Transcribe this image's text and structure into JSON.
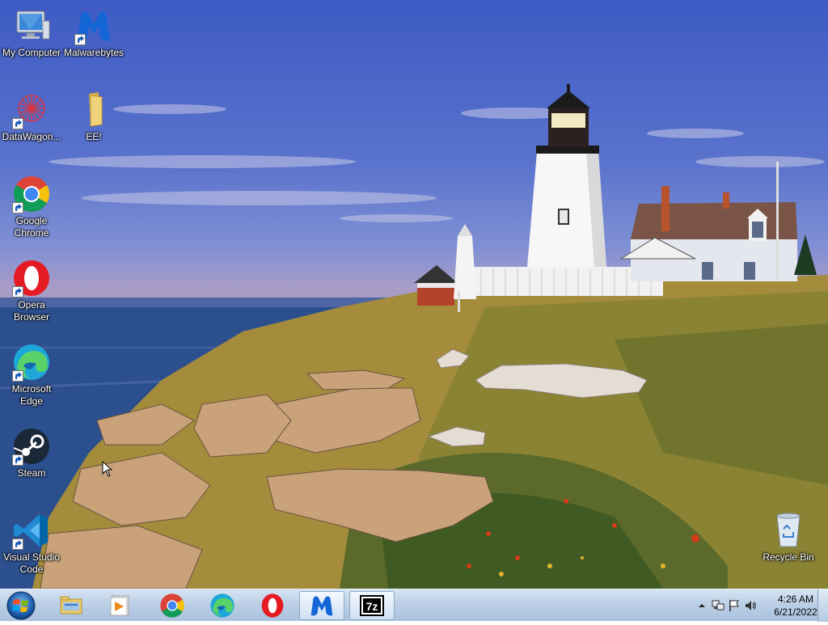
{
  "desktop": {
    "icons": [
      {
        "label": "My Computer",
        "icon": "computer-icon",
        "shortcut": false
      },
      {
        "label": "Malwarebytes",
        "icon": "malwarebytes-icon",
        "shortcut": true
      },
      {
        "label": "DataWagon...",
        "icon": "datawagon-icon",
        "shortcut": true
      },
      {
        "label": "EE!",
        "icon": "folder-icon",
        "shortcut": false
      },
      {
        "label": "Google Chrome",
        "icon": "chrome-icon",
        "shortcut": true
      },
      {
        "label": "Opera Browser",
        "icon": "opera-icon",
        "shortcut": true
      },
      {
        "label": "Microsoft Edge",
        "icon": "edge-icon",
        "shortcut": true
      },
      {
        "label": "Steam",
        "icon": "steam-icon",
        "shortcut": true
      },
      {
        "label": "Visual Studio Code",
        "icon": "vscode-icon",
        "shortcut": true
      },
      {
        "label": "Recycle Bin",
        "icon": "recycle-bin-icon",
        "shortcut": false
      }
    ]
  },
  "taskbar": {
    "start": {
      "icon": "windows-logo-icon"
    },
    "apps": [
      {
        "name": "File Explorer",
        "icon": "file-explorer-icon",
        "active": false
      },
      {
        "name": "Media Player",
        "icon": "media-player-icon",
        "active": false
      },
      {
        "name": "Google Chrome",
        "icon": "chrome-icon",
        "active": false
      },
      {
        "name": "Microsoft Edge",
        "icon": "edge-icon",
        "active": false
      },
      {
        "name": "Opera",
        "icon": "opera-icon",
        "active": false
      },
      {
        "name": "Malwarebytes",
        "icon": "malwarebytes-icon",
        "active": true
      },
      {
        "name": "7-Zip",
        "icon": "7zip-icon",
        "active": true
      }
    ],
    "tray": {
      "icons": [
        "show-hidden-icons-icon",
        "network-icon",
        "action-center-flag-icon",
        "volume-icon"
      ],
      "time": "4:26 AM",
      "date": "6/21/2022"
    }
  },
  "colors": {
    "sky_top": "#3e5bc4",
    "sea": "#2c4f8e",
    "taskbar": "#bcd0e6",
    "grass": "#9a8a3a"
  }
}
